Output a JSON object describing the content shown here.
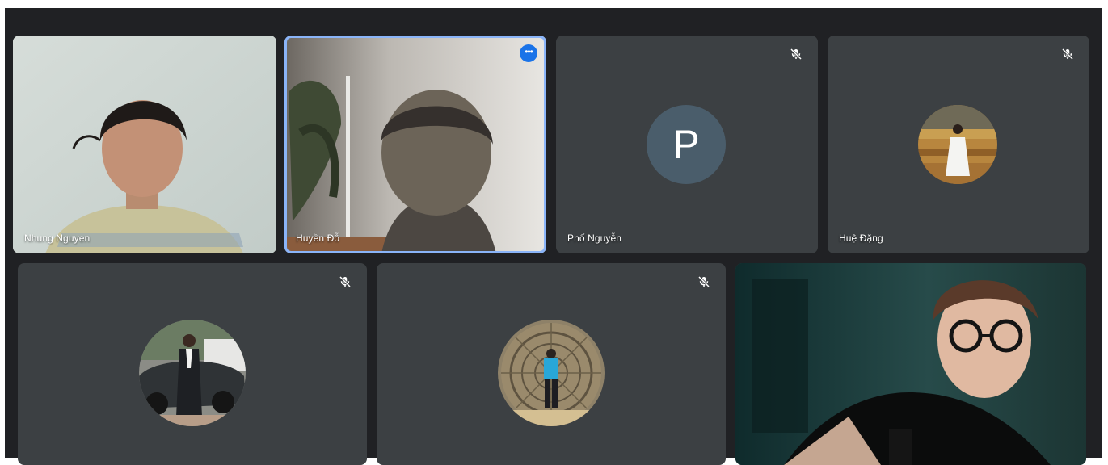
{
  "meeting": {
    "participants": [
      {
        "name": "Nhung Nguyen",
        "type": "video"
      },
      {
        "name": "Huyền Đỗ",
        "type": "video",
        "active": true,
        "more_label": "•••"
      },
      {
        "name": "Phố Nguyễn",
        "type": "letter-avatar",
        "initial": "P",
        "muted": true
      },
      {
        "name": "Huệ Đặng",
        "type": "photo-avatar",
        "muted": true
      },
      {
        "name": "",
        "type": "photo-avatar",
        "muted": true
      },
      {
        "name": "",
        "type": "photo-avatar",
        "muted": true
      },
      {
        "name": "",
        "type": "video"
      }
    ]
  },
  "icons": {
    "mute": "mic-off-icon",
    "more": "more-options-icon"
  },
  "colors": {
    "stage_bg": "#202124",
    "tile_bg": "#3c4043",
    "active_border": "#8ab4f8",
    "more_button": "#1a73e8",
    "letter_avatar_bg": "#4a5d6b"
  }
}
